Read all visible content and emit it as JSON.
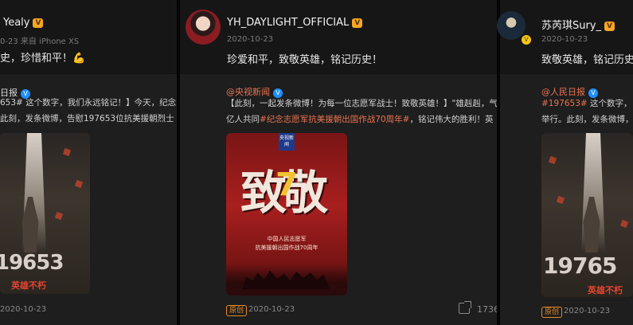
{
  "posts": [
    {
      "user_name": "Yealy",
      "meta": "0-23  来自 iPhone XS",
      "text": "史，珍惜和平！💪",
      "embed_source": "日报",
      "embed_line1": "653# 这个数字，我们永远铭记！】今天，纪念",
      "embed_line2": "此刻，发条微博，告慰197653位抗美援朝烈士",
      "image_number": "19653",
      "image_label": "英雄不朽",
      "footer_date": "2020-10-23"
    },
    {
      "user_name": "YH_DAYLIGHT_OFFICIAL",
      "meta": "2020-10-23",
      "text": "珍爱和平，致敬英雄，铭记历史！",
      "embed_source": "@央视新闻",
      "embed_line1": "【此刻，一起发条微博！为每一位志愿军战士！致敬英雄！】\"雄赳赳，气",
      "embed_line2_prefix": "亿人共同",
      "embed_line2_hashtag": "#纪念志愿军抗美援朝出国作战70周年#",
      "embed_line2_suffix": "，铭记伟大的胜利！英",
      "image_title": "致敬",
      "image_number": "7",
      "image_logo": "央视新闻",
      "image_caption_1": "中国人民志愿军",
      "image_caption_2": "抗美援朝出国作战70周年",
      "tag": "原创",
      "footer_date": "2020-10-23",
      "share_count": "1736"
    },
    {
      "user_name": "苏芮琪Sury_",
      "meta": "2020-10-23",
      "text": "致敬英雄，铭记历史！",
      "embed_source": "@人民日报",
      "embed_line1_hashtag": "#197653#",
      "embed_line1_suffix": " 这个数字，",
      "embed_line2": "举行。此刻，发条微博，",
      "image_number": "19765",
      "image_label": "英雄不朽",
      "tag": "原创",
      "footer_date": "2020-10-23"
    }
  ],
  "colors": {
    "accent_orange": "#eb7350",
    "badge_gold": "#f5a623",
    "verified_blue": "#1e90ff"
  }
}
